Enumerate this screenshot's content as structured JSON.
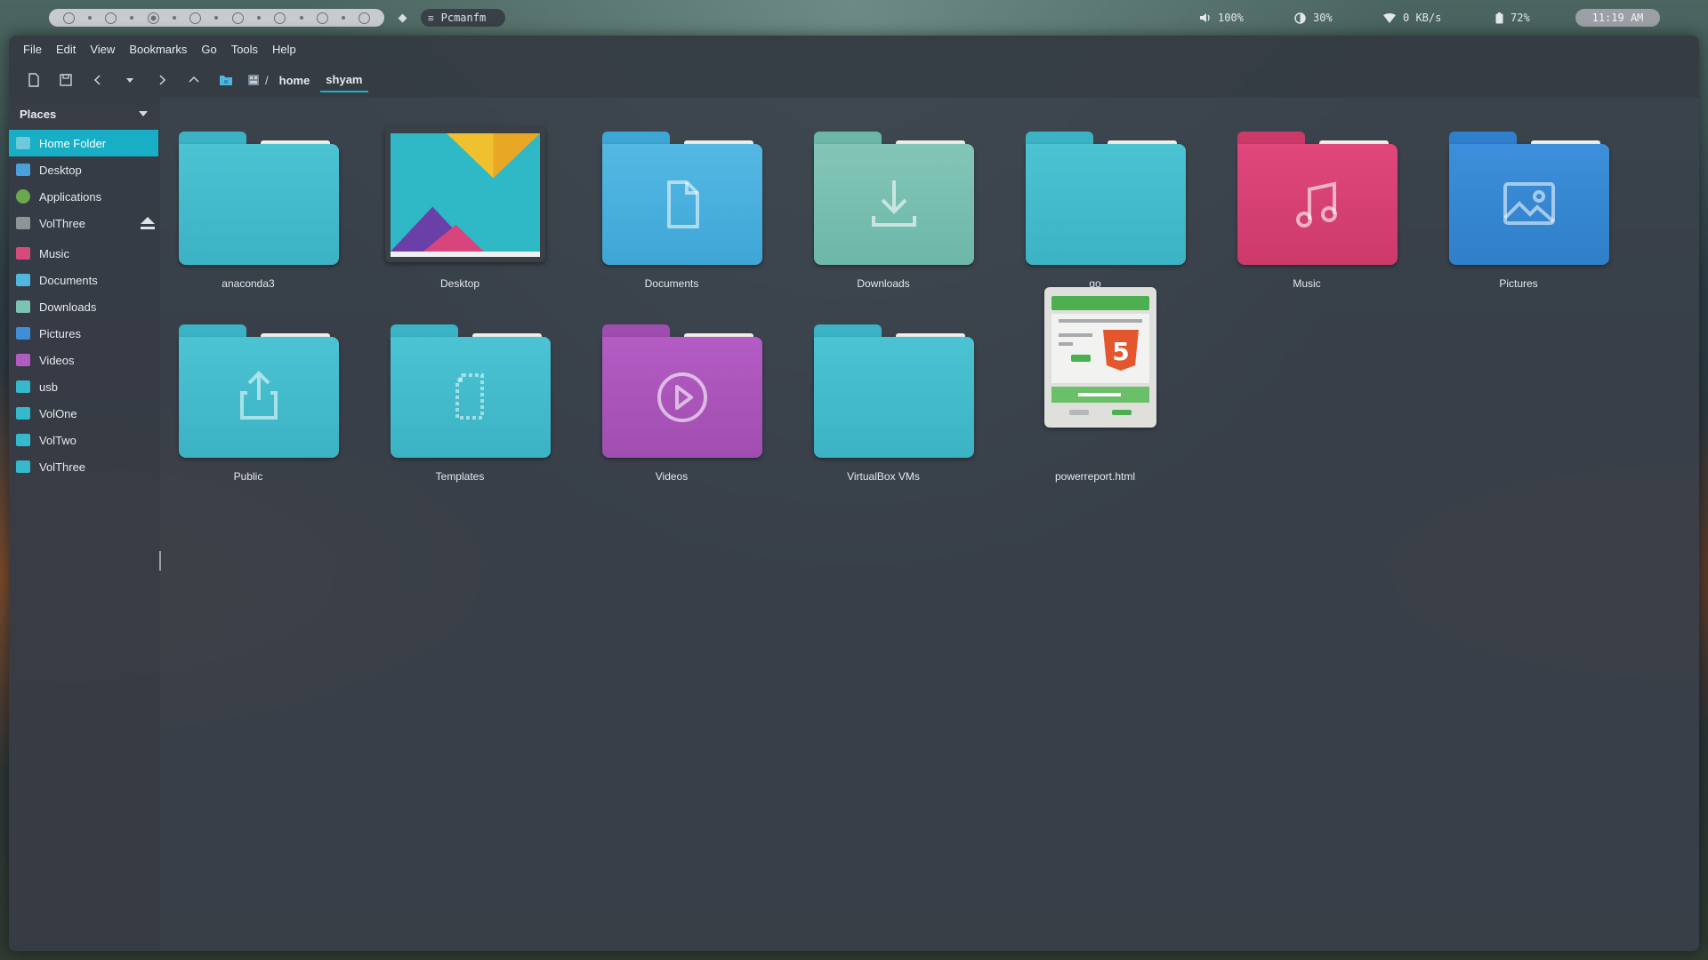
{
  "topbar": {
    "workspaces_count": 8,
    "active_workspace": 3,
    "task": {
      "glyph": "≡",
      "label": "Pcmanfm"
    },
    "volume": {
      "icon": "speaker-icon",
      "text": "100%"
    },
    "brightness": {
      "icon": "brightness-icon",
      "text": "30%"
    },
    "network": {
      "icon": "wifi-icon",
      "text": "0 KB/s"
    },
    "battery": {
      "icon": "battery-icon",
      "text": "72%"
    },
    "clock": "11:19 AM"
  },
  "menubar": [
    "File",
    "Edit",
    "View",
    "Bookmarks",
    "Go",
    "Tools",
    "Help"
  ],
  "toolbar": {
    "buttons": [
      "new-window-icon",
      "new-tab-icon",
      "back-icon",
      "history-dropdown-icon",
      "forward-icon",
      "up-icon",
      "home-icon"
    ],
    "breadcrumb": {
      "root_sep": "/",
      "items": [
        "home",
        "shyam"
      ]
    }
  },
  "sidebar": {
    "header": "Places",
    "items": [
      {
        "label": "Home Folder",
        "icon": "home-folder-icon",
        "color": "#6ec9d8",
        "active": true
      },
      {
        "label": "Desktop",
        "icon": "desktop-icon",
        "color": "#4aa0d8"
      },
      {
        "label": "Applications",
        "icon": "applications-icon",
        "color": "#6aa84f"
      },
      {
        "label": "VolThree",
        "icon": "drive-icon",
        "color": "#8f949a",
        "eject": true
      },
      {
        "label": "Music",
        "icon": "music-folder-icon",
        "color": "#d94a7c"
      },
      {
        "label": "Documents",
        "icon": "documents-folder-icon",
        "color": "#4fb6e0"
      },
      {
        "label": "Downloads",
        "icon": "downloads-folder-icon",
        "color": "#7cc3b4"
      },
      {
        "label": "Pictures",
        "icon": "pictures-folder-icon",
        "color": "#3e8fd8"
      },
      {
        "label": "Videos",
        "icon": "videos-folder-icon",
        "color": "#b35cc0"
      },
      {
        "label": "usb",
        "icon": "folder-icon",
        "color": "#36b9cc"
      },
      {
        "label": "VolOne",
        "icon": "folder-icon",
        "color": "#36b9cc"
      },
      {
        "label": "VolTwo",
        "icon": "folder-icon",
        "color": "#36b9cc"
      },
      {
        "label": "VolThree",
        "icon": "folder-icon",
        "color": "#36b9cc"
      }
    ]
  },
  "files": [
    {
      "label": "anaconda3",
      "kind": "folder",
      "color": "#4cc3d3",
      "tab": "#3bb3c4",
      "glyph": "none"
    },
    {
      "label": "Desktop",
      "kind": "desktop"
    },
    {
      "label": "Documents",
      "kind": "folder",
      "color": "#55b8e4",
      "tab": "#3ea6d6",
      "glyph": "document"
    },
    {
      "label": "Downloads",
      "kind": "folder",
      "color": "#83c6b8",
      "tab": "#6db7a8",
      "glyph": "download"
    },
    {
      "label": "go",
      "kind": "folder",
      "color": "#4cc3d3",
      "tab": "#3bb3c4",
      "glyph": "none"
    },
    {
      "label": "Music",
      "kind": "folder",
      "color": "#e0477b",
      "tab": "#cc3a6a",
      "glyph": "music"
    },
    {
      "label": "Pictures",
      "kind": "folder",
      "color": "#3c8fda",
      "tab": "#2f7fca",
      "glyph": "picture"
    },
    {
      "label": "Public",
      "kind": "folder",
      "color": "#4cc3d3",
      "tab": "#3bb3c4",
      "glyph": "share"
    },
    {
      "label": "Templates",
      "kind": "folder",
      "color": "#4cc3d3",
      "tab": "#3bb3c4",
      "glyph": "template"
    },
    {
      "label": "Videos",
      "kind": "folder",
      "color": "#b45cc4",
      "tab": "#a04db0",
      "glyph": "play"
    },
    {
      "label": "VirtualBox VMs",
      "kind": "folder",
      "color": "#4cc3d3",
      "tab": "#3bb3c4",
      "glyph": "none"
    },
    {
      "label": "powerreport.html",
      "kind": "html"
    }
  ]
}
